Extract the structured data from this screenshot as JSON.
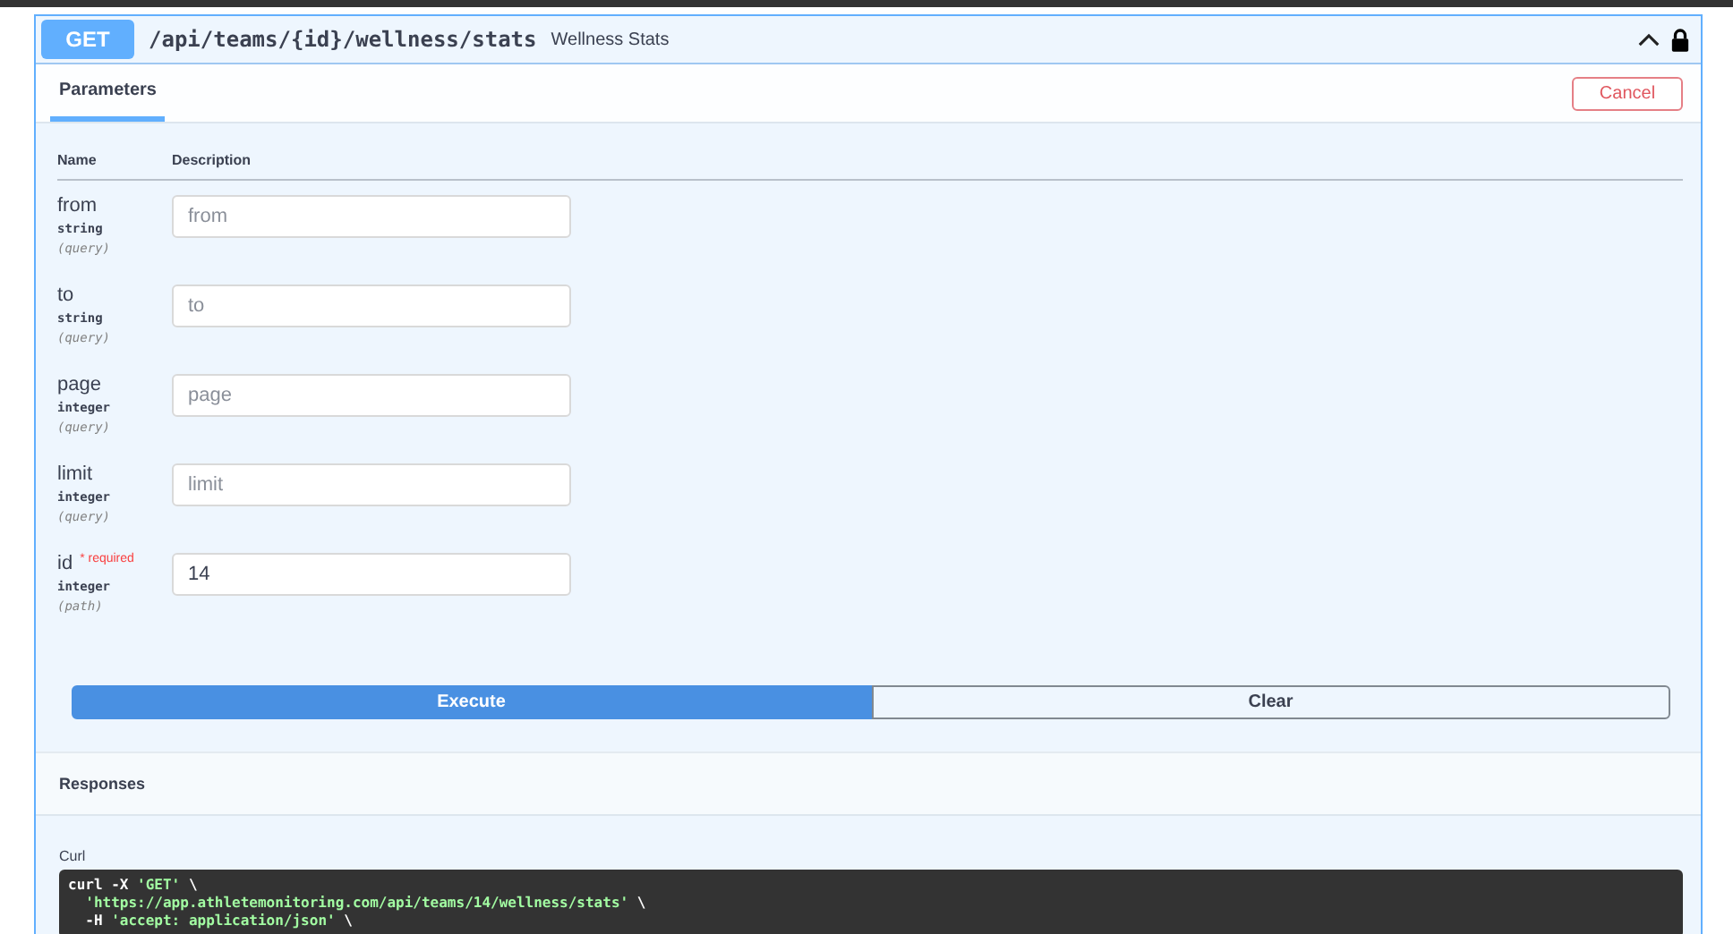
{
  "operation": {
    "method": "GET",
    "path": "/api/teams/{id}/wellness/stats",
    "summary": "Wellness Stats",
    "expanded": true,
    "locked": true
  },
  "tabs": [
    {
      "label": "Parameters",
      "selected": true
    }
  ],
  "cancel_button": "Cancel",
  "table": {
    "columns": [
      "Name",
      "Description"
    ],
    "rows": [
      {
        "name": "from",
        "type": "string",
        "location": "(query)",
        "placeholder": "from"
      },
      {
        "name": "to",
        "type": "string",
        "location": "(query)",
        "placeholder": "to"
      },
      {
        "name": "page",
        "type": "integer",
        "location": "(query)",
        "placeholder": "page"
      },
      {
        "name": "limit",
        "type": "integer",
        "location": "(query)",
        "placeholder": "limit"
      },
      {
        "name": "id",
        "type": "integer",
        "location": "(path)",
        "required_label": "* required",
        "value": "14"
      }
    ]
  },
  "buttons": {
    "execute": "Execute",
    "clear": "Clear"
  },
  "responses": {
    "title": "Responses",
    "curl_label": "Curl",
    "curl_lines": [
      "curl -X 'GET' \\",
      "  'https://app.athletemonitoring.com/api/teams/14/wellness/stats' \\",
      "  -H 'accept: application/json' \\"
    ]
  }
}
